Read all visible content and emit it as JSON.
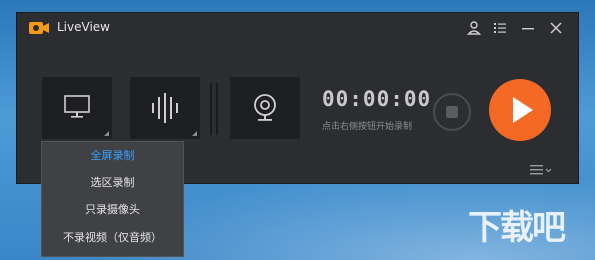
{
  "window": {
    "title": "LiveView"
  },
  "titlebar": {
    "icons": [
      "user-icon",
      "list-icon",
      "minimize-icon",
      "close-icon"
    ]
  },
  "modes": [
    {
      "name": "screen",
      "icon": "monitor-icon"
    },
    {
      "name": "audio",
      "icon": "audio-wave-icon"
    },
    {
      "name": "webcam",
      "icon": "webcam-icon"
    }
  ],
  "recorder": {
    "timer": "00:00:00",
    "hint": "点击右侧按钮开始录制"
  },
  "dropdown": {
    "items": [
      "全屏录制",
      "选区录制",
      "只录摄像头",
      "不录视频（仅音频）"
    ],
    "active_index": 0
  },
  "colors": {
    "accent": "#f46a25",
    "active_text": "#3aa0ff",
    "window_bg": "#2b2d31"
  },
  "watermark": "下载吧"
}
